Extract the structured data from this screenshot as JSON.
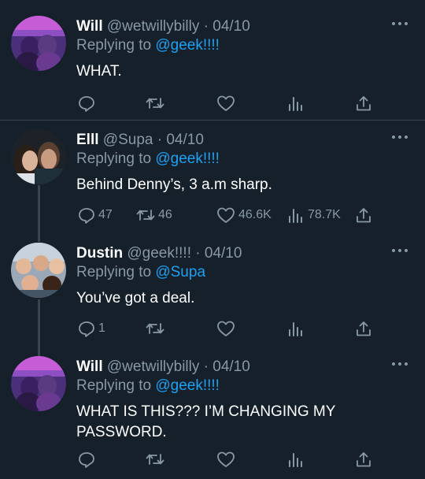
{
  "tweets": [
    {
      "name": "Will",
      "handle": "@wetwillybilly",
      "date": "· 04/10",
      "reply_prefix": "Replying to",
      "reply_to": "@geek!!!!",
      "text": "WHAT.",
      "counts": {
        "reply": "",
        "retweet": "",
        "like": "",
        "views": ""
      }
    },
    {
      "name": "Elll",
      "handle": "@Supa",
      "date": "· 04/10",
      "reply_prefix": "Replying to",
      "reply_to": "@geek!!!!",
      "text": "Behind Denny’s, 3 a.m sharp.",
      "counts": {
        "reply": "47",
        "retweet": "46",
        "like": "46.6K",
        "views": "78.7K"
      }
    },
    {
      "name": "Dustin",
      "handle": "@geek!!!!",
      "date": "· 04/10",
      "reply_prefix": "Replying to",
      "reply_to": "@Supa",
      "text": "You’ve got a deal.",
      "counts": {
        "reply": "1",
        "retweet": "",
        "like": "",
        "views": ""
      }
    },
    {
      "name": "Will",
      "handle": "@wetwillybilly",
      "date": "· 04/10",
      "reply_prefix": "Replying to",
      "reply_to": "@geek!!!!",
      "text": "WHAT IS THIS??? I’M CHANGING MY PASSWORD.",
      "counts": {
        "reply": "",
        "retweet": "",
        "like": "",
        "views": ""
      }
    }
  ],
  "icons": [
    "reply-icon",
    "retweet-icon",
    "like-icon",
    "views-icon",
    "share-icon",
    "more-icon"
  ],
  "colors": {
    "background": "#15202b",
    "muted": "#8899a6",
    "accent": "#1da1f2",
    "divider": "#38444d"
  }
}
